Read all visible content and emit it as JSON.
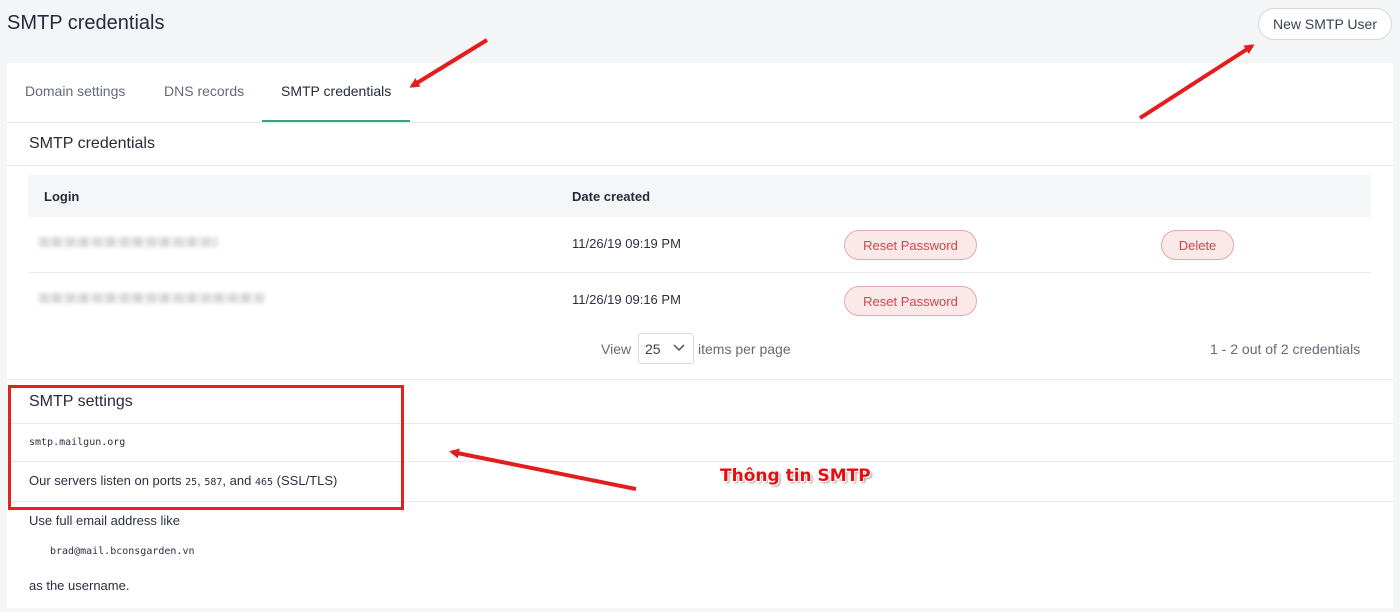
{
  "page": {
    "title": "SMTP credentials",
    "new_button": "New SMTP User"
  },
  "tabs": [
    {
      "label": "Domain settings",
      "active": false
    },
    {
      "label": "DNS records",
      "active": false
    },
    {
      "label": "SMTP credentials",
      "active": true
    }
  ],
  "credentials": {
    "title": "SMTP credentials",
    "columns": [
      "Login",
      "Date created"
    ],
    "rows": [
      {
        "login": "",
        "date": "11/26/19 09:19 PM",
        "reset_label": "Reset Password",
        "delete_label": "Delete"
      },
      {
        "login": "",
        "date": "11/26/19 09:16 PM",
        "reset_label": "Reset Password"
      }
    ],
    "pagination": {
      "view_label": "View",
      "per_page": "25",
      "items_label": "items per page",
      "count_text": "1 - 2 out of 2 credentials"
    }
  },
  "settings": {
    "title": "SMTP settings",
    "host": "smtp.mailgun.org",
    "ports_prefix": "Our servers listen on ports",
    "port1": "25",
    "port2": "587",
    "and_text": "and",
    "port3": "465",
    "ports_suffix": "(SSL/TLS)",
    "username_intro": "Use full email address like",
    "example_email": "brad@mail.bconsgarden.vn",
    "username_outro": "as the username."
  },
  "annotation": {
    "label": "Thông tin SMTP",
    "color": "#e50f0f"
  },
  "colors": {
    "accent": "#3aa27e",
    "danger": "#c9474d"
  }
}
